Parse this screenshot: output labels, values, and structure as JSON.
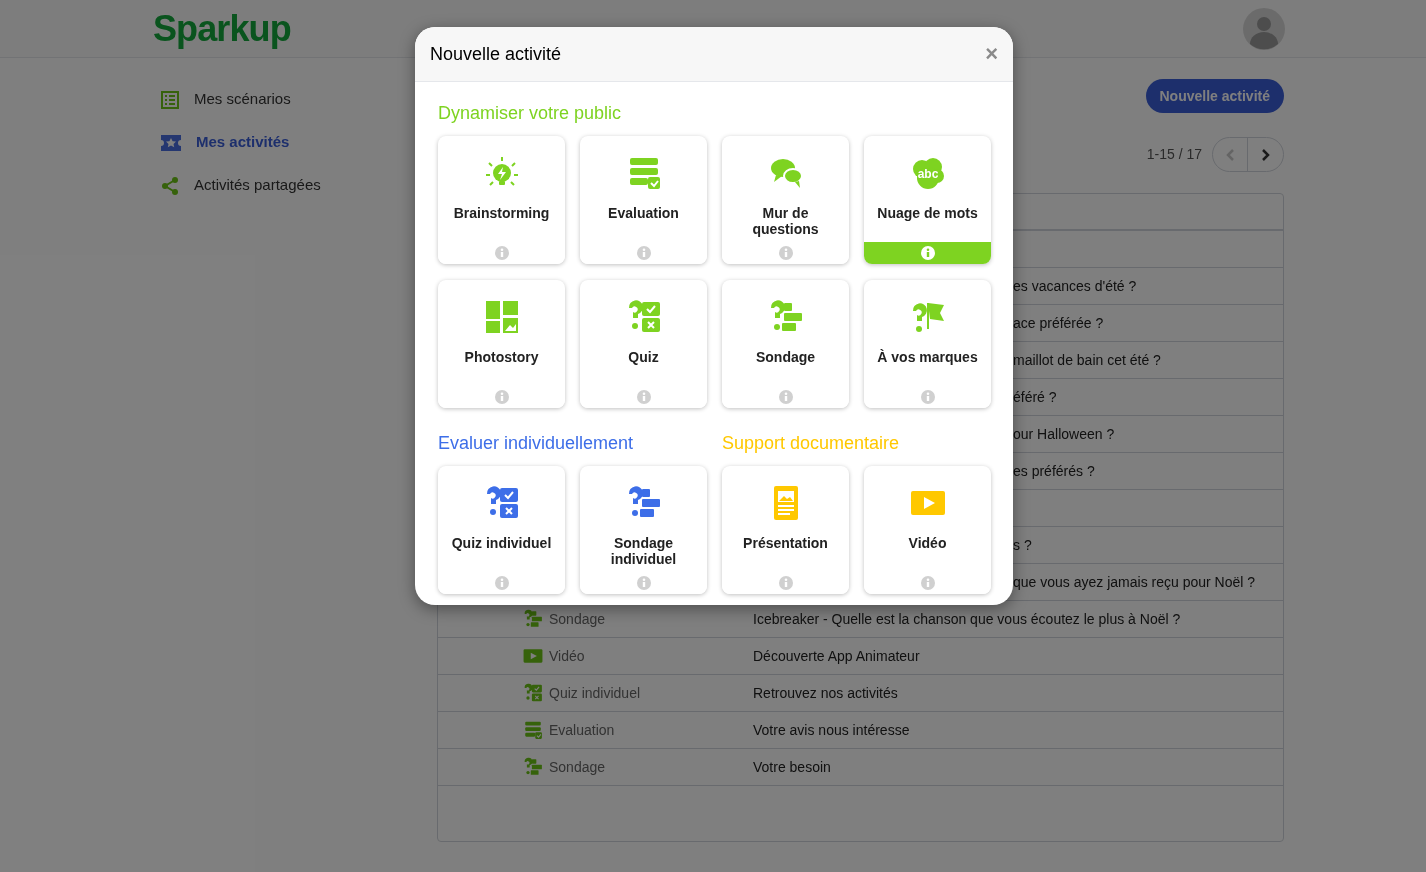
{
  "header": {
    "logo": "Sparkup"
  },
  "sidebar": {
    "items": [
      {
        "label": "Mes scénarios",
        "selected": false
      },
      {
        "label": "Mes activités",
        "selected": true
      },
      {
        "label": "Activités partagées",
        "selected": false
      }
    ]
  },
  "new_button": "Nouvelle activité",
  "pagination": {
    "range": "1-15 / 17",
    "prev_disabled": true,
    "next_disabled": false
  },
  "table": {
    "rows": [
      {},
      {
        "covered": true,
        "title": "es vacances d'été ?"
      },
      {
        "covered": true,
        "title": "ace préférée ?"
      },
      {
        "covered": true,
        "title": "maillot de bain cet été ?"
      },
      {
        "covered": true,
        "title": "éféré ?"
      },
      {
        "covered": true,
        "title": "our Halloween ?"
      },
      {
        "covered": true,
        "title": "es préférés ?"
      },
      {},
      {
        "covered": true,
        "title": "s ?"
      },
      {
        "covered": true,
        "title": "que vous ayez jamais reçu pour Noël ?"
      },
      {
        "covered": false,
        "kind": "poll",
        "type": "Sondage",
        "title": "Icebreaker - Quelle est la chanson que vous écoutez le plus à Noël ?"
      },
      {
        "covered": false,
        "kind": "video",
        "type": "Vidéo",
        "title": "Découverte App Animateur"
      },
      {
        "covered": false,
        "kind": "quiz",
        "type": "Quiz individuel",
        "title": "Retrouvez nos activités"
      },
      {
        "covered": false,
        "kind": "evaluation",
        "type": "Evaluation",
        "title": "Votre avis nous intéresse"
      },
      {
        "covered": false,
        "kind": "poll",
        "type": "Sondage",
        "title": "Votre besoin"
      }
    ]
  },
  "modal": {
    "title": "Nouvelle activité",
    "close": "×",
    "sections": [
      {
        "title": "Dynamiser votre public",
        "color": "#7ed321",
        "cards": [
          {
            "label": "Brainstorming",
            "kind": "brainstorming",
            "selected": false
          },
          {
            "label": "Evaluation",
            "kind": "evaluation",
            "selected": false
          },
          {
            "label": "Mur de questions",
            "kind": "wall",
            "selected": false
          },
          {
            "label": "Nuage de mots",
            "kind": "cloud",
            "icon_text": "abc",
            "selected": true
          },
          {
            "label": "Photostory",
            "kind": "photostory",
            "selected": false
          },
          {
            "label": "Quiz",
            "kind": "quiz",
            "selected": false
          },
          {
            "label": "Sondage",
            "kind": "poll",
            "selected": false
          },
          {
            "label": "À vos marques",
            "kind": "brand",
            "selected": false
          }
        ]
      },
      {
        "title": "Evaluer individuellement",
        "color": "#3d6ee8",
        "cards": [
          {
            "label": "Quiz individuel",
            "kind": "quiz",
            "selected": false
          },
          {
            "label": "Sondage individuel",
            "kind": "poll",
            "selected": false
          }
        ]
      },
      {
        "title": "Support documentaire",
        "color": "#ffc800",
        "cards": [
          {
            "label": "Présentation",
            "kind": "presentation",
            "selected": false
          },
          {
            "label": "Vidéo",
            "kind": "video",
            "selected": false
          }
        ]
      }
    ]
  }
}
